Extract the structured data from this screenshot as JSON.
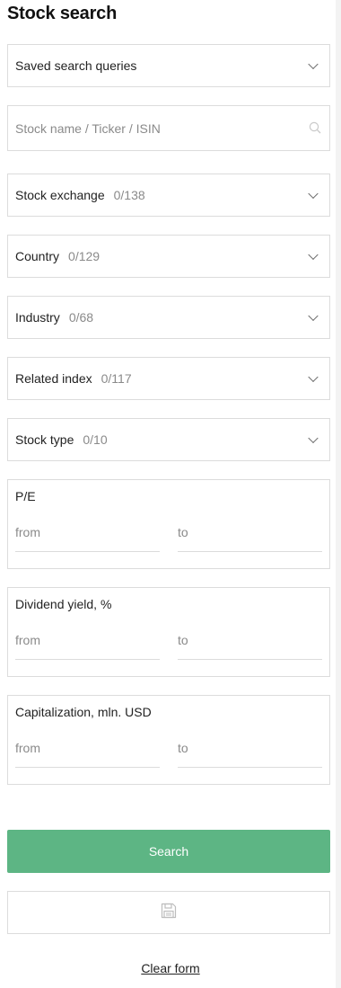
{
  "page": {
    "title": "Stock search"
  },
  "saved_queries": {
    "label": "Saved search queries"
  },
  "search": {
    "placeholder": "Stock name / Ticker / ISIN"
  },
  "filters": {
    "exchange": {
      "label": "Stock exchange",
      "count": "0/138"
    },
    "country": {
      "label": "Country",
      "count": "0/129"
    },
    "industry": {
      "label": "Industry",
      "count": "0/68"
    },
    "index": {
      "label": "Related index",
      "count": "0/117"
    },
    "type": {
      "label": "Stock type",
      "count": "0/10"
    }
  },
  "ranges": {
    "pe": {
      "label": "P/E",
      "from": "from",
      "to": "to"
    },
    "dividend": {
      "label": "Dividend yield, %",
      "from": "from",
      "to": "to"
    },
    "cap": {
      "label": "Capitalization, mln. USD",
      "from": "from",
      "to": "to"
    }
  },
  "actions": {
    "search_label": "Search",
    "save_icon": "floppy-disk-icon",
    "clear_label": "Clear form"
  },
  "colors": {
    "accent": "#5db584",
    "border": "#dcdcdc",
    "muted": "#8a8a8a"
  }
}
